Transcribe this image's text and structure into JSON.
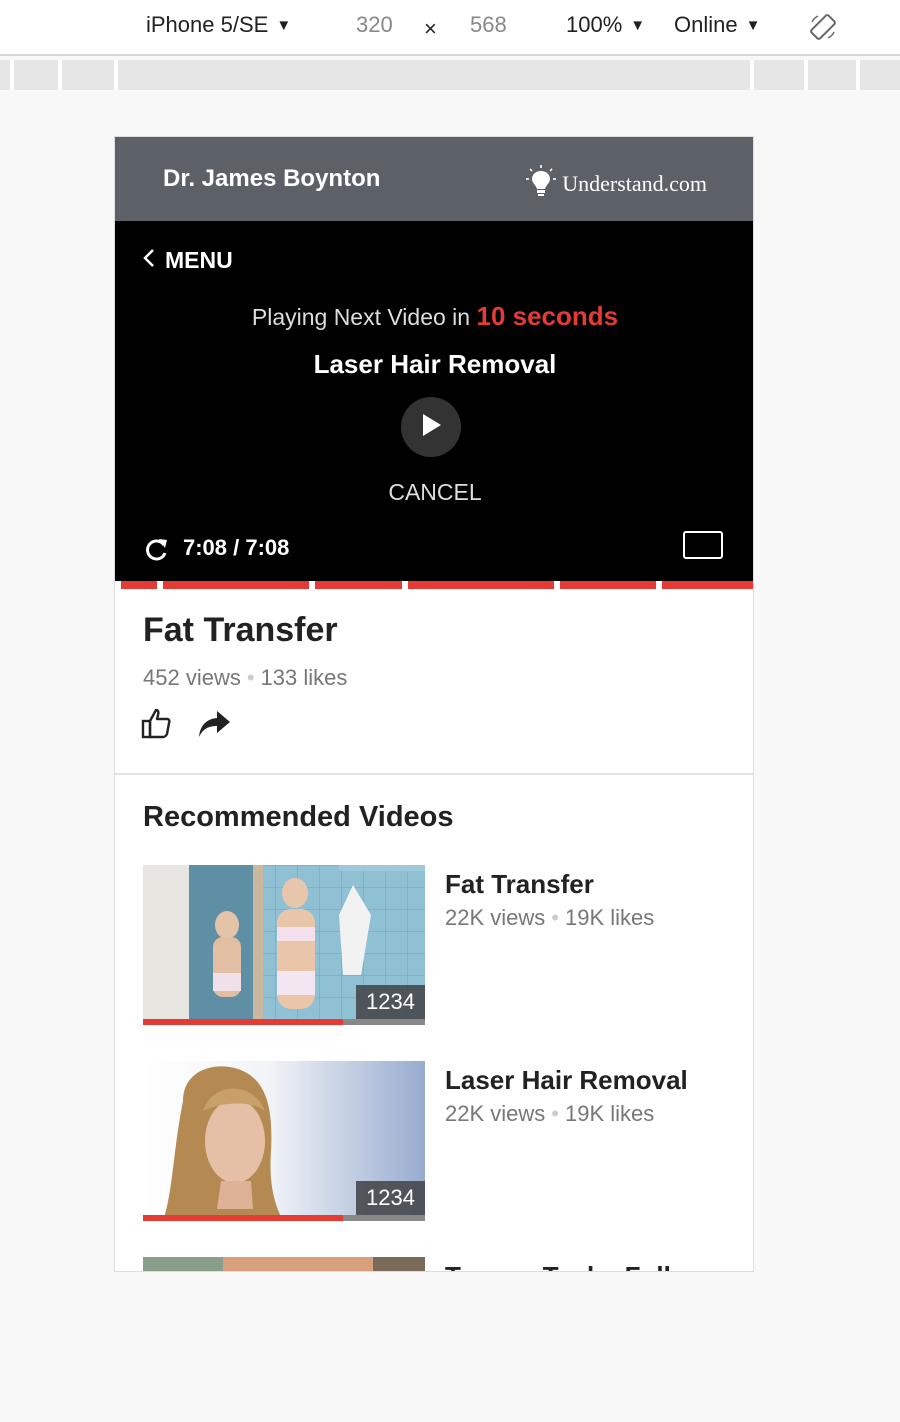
{
  "devtools": {
    "device": "iPhone 5/SE",
    "width": "320",
    "times": "×",
    "height": "568",
    "zoom": "100%",
    "network": "Online"
  },
  "header": {
    "doctor": "Dr. James Boynton",
    "brand": "Understand.com"
  },
  "player": {
    "menu_label": "MENU",
    "next_prefix": "Playing Next Video in",
    "next_seconds": "10 seconds",
    "next_title": "Laser Hair Removal",
    "cancel_label": "CANCEL",
    "time": "7:08 / 7:08",
    "accent_color": "#e43b35"
  },
  "video": {
    "title": "Fat Transfer",
    "views": "452 views",
    "likes": "133 likes"
  },
  "recommended": {
    "heading": "Recommended Videos",
    "items": [
      {
        "title": "Fat Transfer",
        "views": "22K views",
        "likes": "19K likes",
        "badge": "1234",
        "progress": 0.71
      },
      {
        "title": "Laser Hair Removal",
        "views": "22K views",
        "likes": "19K likes",
        "badge": "1234",
        "progress": 0.71
      },
      {
        "title": "Tummy Tuck - Full",
        "views": "",
        "likes": "",
        "badge": "",
        "progress": 0
      }
    ]
  }
}
